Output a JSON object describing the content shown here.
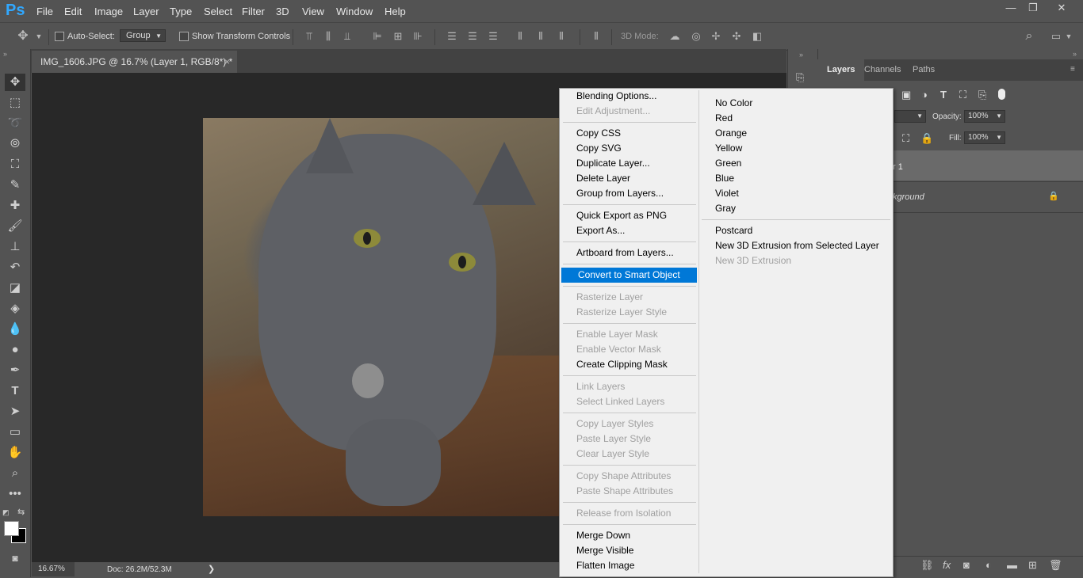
{
  "app": {
    "logo": "Ps"
  },
  "menubar": {
    "items": [
      "File",
      "Edit",
      "Image",
      "Layer",
      "Type",
      "Select",
      "Filter",
      "3D",
      "View",
      "Window",
      "Help"
    ],
    "window_controls": [
      "—",
      "❐",
      "✕"
    ]
  },
  "options_bar": {
    "auto_select_label": "Auto-Select:",
    "auto_select_value": "Group",
    "show_transform_label": "Show Transform Controls",
    "mode_3d_label": "3D Mode:"
  },
  "document": {
    "tab_title": "IMG_1606.JPG @ 16.7% (Layer 1, RGB/8*) *",
    "tab_close": "×"
  },
  "status": {
    "zoom": "16.67%",
    "doc_info": "Doc: 26.2M/52.3M",
    "arrow": "❯"
  },
  "panels": {
    "collapse_arrows": "»",
    "tabs": {
      "layers": "Layers",
      "channels": "Channels",
      "paths": "Paths"
    },
    "opacity_label": "Opacity:",
    "opacity_value": "100%",
    "fill_label": "Fill:",
    "fill_value": "100%",
    "layers": {
      "layer1": "r 1",
      "background": "kground"
    }
  },
  "context_menu": {
    "left": {
      "blending_options": "Blending Options...",
      "edit_adjustment": "Edit Adjustment...",
      "copy_css": "Copy CSS",
      "copy_svg": "Copy SVG",
      "duplicate_layer": "Duplicate Layer...",
      "delete_layer": "Delete Layer",
      "group_from_layers": "Group from Layers...",
      "quick_export": "Quick Export as PNG",
      "export_as": "Export As...",
      "artboard_from_layers": "Artboard from Layers...",
      "convert_smart_object": "Convert to Smart Object",
      "rasterize_layer": "Rasterize Layer",
      "rasterize_layer_style": "Rasterize Layer Style",
      "enable_layer_mask": "Enable Layer Mask",
      "enable_vector_mask": "Enable Vector Mask",
      "create_clipping_mask": "Create Clipping Mask",
      "link_layers": "Link Layers",
      "select_linked_layers": "Select Linked Layers",
      "copy_layer_styles": "Copy Layer Styles",
      "paste_layer_style": "Paste Layer Style",
      "clear_layer_style": "Clear Layer Style",
      "copy_shape_attributes": "Copy Shape Attributes",
      "paste_shape_attributes": "Paste Shape Attributes",
      "release_from_isolation": "Release from Isolation",
      "merge_down": "Merge Down",
      "merge_visible": "Merge Visible",
      "flatten_image": "Flatten Image"
    },
    "right": {
      "no_color": "No Color",
      "red": "Red",
      "orange": "Orange",
      "yellow": "Yellow",
      "green": "Green",
      "blue": "Blue",
      "violet": "Violet",
      "gray": "Gray",
      "postcard": "Postcard",
      "new_3d_extrusion_selected": "New 3D Extrusion from Selected Layer",
      "new_3d_extrusion": "New 3D Extrusion"
    }
  },
  "colors": {
    "accent_highlight": "#0078d7",
    "ps_logo": "#31a8ff",
    "ui_gray": "#535353",
    "canvas_bg": "#282828"
  }
}
